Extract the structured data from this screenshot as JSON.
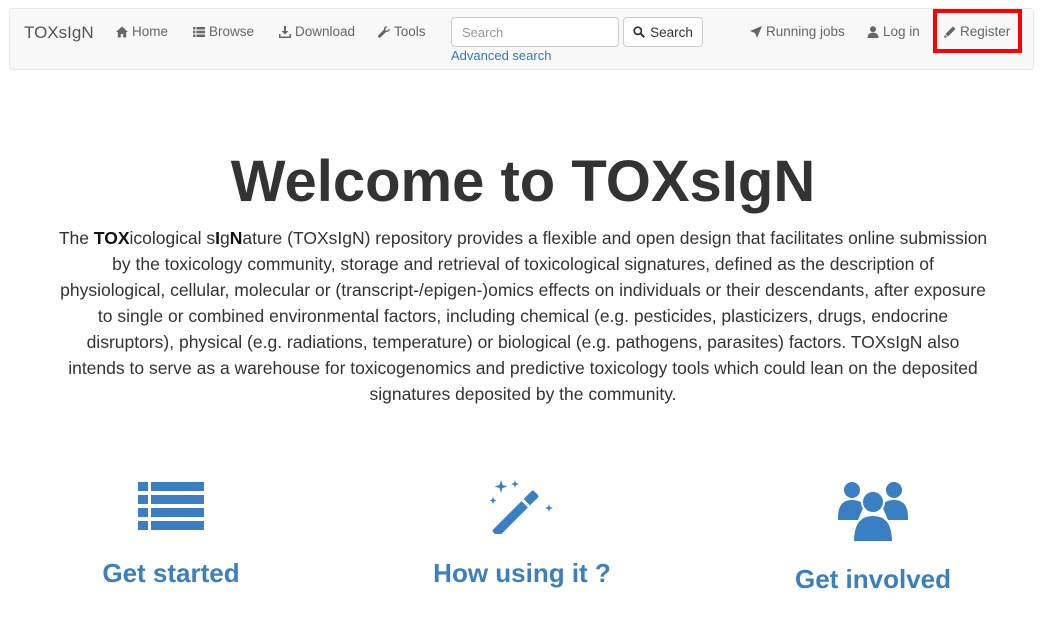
{
  "navbar": {
    "brand": "TOXsIgN",
    "home": "Home",
    "browse": "Browse",
    "download": "Download",
    "tools": "Tools",
    "search_placeholder": "Search",
    "search_button": "Search",
    "advanced_search": "Advanced search",
    "running_jobs": "Running jobs",
    "login": "Log in",
    "register": "Register"
  },
  "hero": {
    "title": "Welcome to TOXsIgN",
    "intro_the": "The ",
    "intro_tox": "TOX",
    "intro_icological": "icological s",
    "intro_i": "I",
    "intro_g": "g",
    "intro_n": "N",
    "intro_rest": "ature (TOXsIgN) repository provides a flexible and open design that facilitates online submission by the toxicology community, storage and retrieval of toxicological signatures, defined as the description of physiological, cellular, molecular or (transcript-/epigen-)omics effects on individuals or their descendants, after exposure to single or combined environmental factors, including chemical (e.g. pesticides, plasticizers, drugs, endocrine disruptors), physical (e.g. radiations, temperature) or biological (e.g. pathogens, parasites) factors. TOXsIgN also intends to serve as a warehouse for toxicogenomics and predictive toxicology tools which could lean on the deposited signatures deposited by the community."
  },
  "features": [
    {
      "label": "Get started",
      "icon": "list-icon"
    },
    {
      "label": "How using it ?",
      "icon": "magic-wand-icon"
    },
    {
      "label": "Get involved",
      "icon": "users-icon"
    }
  ],
  "colors": {
    "accent": "#3a7fc1",
    "link": "#337ab7",
    "highlight": "#ff0000"
  }
}
